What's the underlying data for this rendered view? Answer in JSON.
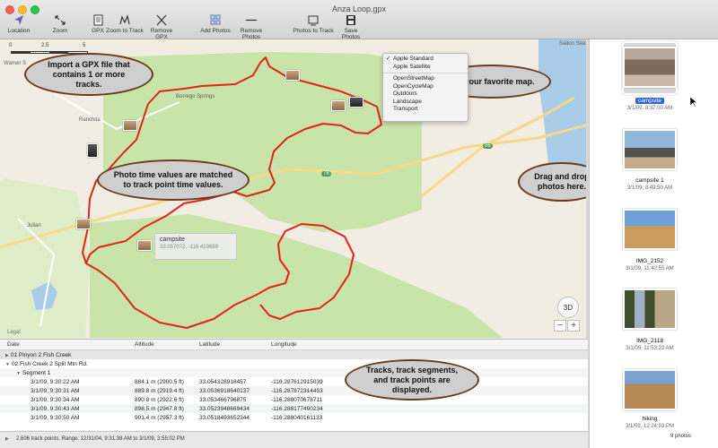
{
  "window": {
    "title": "Anza Loop.gpx"
  },
  "toolbar": {
    "location": "Location",
    "zoom": "Zoom",
    "gpx": "GPX",
    "zoom_to_track": "Zoom to Track",
    "remove_gpx": "Remove GPX",
    "add_photos": "Add Photos",
    "remove_photos": "Remove Photos",
    "photos_to_track": "Photos to Track",
    "save_photos": "Save Photos"
  },
  "map": {
    "scale": [
      "0",
      "2.5",
      "5"
    ],
    "places": [
      "Warner S",
      "Borrego Springs",
      "Ranchita",
      "Julian",
      "Salton Sea"
    ],
    "road_badges": [
      "86",
      "78"
    ],
    "legal": "Legal",
    "ctrl_3d": "3D",
    "zoom_out": "−",
    "zoom_in": "+",
    "tooltip": {
      "title": "campsite",
      "coords": "33.057072, -116.419699"
    },
    "menu": {
      "group1": [
        "Apple Standard",
        "Apple Satellite"
      ],
      "group2": [
        "OpenStreetMap",
        "OpenCycleMap",
        "Outdoors",
        "Landscape",
        "Transport"
      ],
      "checked": "Apple Standard"
    },
    "callouts": {
      "import": "Import a GPX file that contains 1 or more tracks.",
      "favorite": "Use your favorite map.",
      "time": "Photo time values are matched to track point time values.",
      "drag": "Drag and drop photos here.",
      "tracks": "Tracks, track segments, and track points are displayed."
    }
  },
  "table": {
    "headers": [
      "Date",
      "Altitude",
      "Latitude",
      "Longitude"
    ],
    "tracks": [
      "01 Pinyon 2 Fish Creek",
      "02 Fish Creek 2 Split Mtn Rd."
    ],
    "segment": "Segment 1",
    "rows": [
      [
        "3/1/09, 9:30:22 AM",
        "884.1 m (2900.5 ft)",
        "33.054328918457",
        "-116.287612915039"
      ],
      [
        "3/1/09, 9:30:31 AM",
        "889.8 m (2919.4 ft)",
        "33.0536918640137",
        "-116.287872314453"
      ],
      [
        "3/1/09, 9:30:34 AM",
        "890.8 m (2922.6 ft)",
        "33.053466796875",
        "-116.288070678711"
      ],
      [
        "3/1/09, 9:30:43 AM",
        "898.5 m (2947.8 ft)",
        "33.0523948669434",
        "-116.288177490234"
      ],
      [
        "3/1/09, 9:30:50 AM",
        "901.4 m (2957.3 ft)",
        "33.0518493652344",
        "-116.288040161133"
      ]
    ],
    "status": "2,606 track points.  Range: 12/31/04, 9:31:38 AM to 3/1/09, 3:55:02 PM"
  },
  "photos": {
    "items": [
      {
        "name": "campsite",
        "date": "3/1/09, 8:37:00 AM",
        "selected": true
      },
      {
        "name": "campsite 1",
        "date": "3/1/09, 8:49:50 AM",
        "selected": false
      },
      {
        "name": "IMG_2152",
        "date": "3/1/09, 11:42:55 AM",
        "selected": false
      },
      {
        "name": "IMG_2118",
        "date": "3/1/09, 11:53:23 AM",
        "selected": false
      },
      {
        "name": "hiking",
        "date": "3/1/09, 12:24:03 PM",
        "selected": false
      }
    ],
    "count": "9 photos"
  },
  "colors": {
    "track": "#e2231a",
    "park": "#c9e4a8",
    "water": "#a9cce8",
    "callout_border": "#6a3b1c",
    "selection": "#2e63d6"
  }
}
